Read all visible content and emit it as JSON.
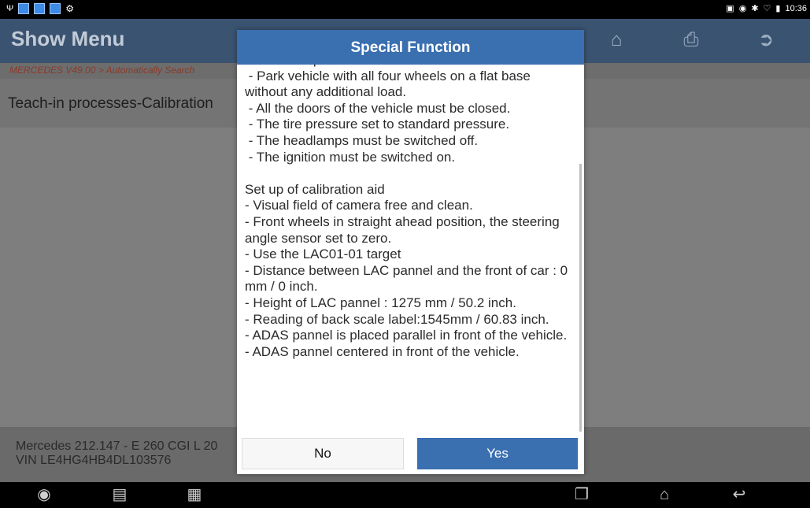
{
  "status_bar": {
    "time": "10:36"
  },
  "header": {
    "title": "Show Menu"
  },
  "toolbar": {
    "home_icon": "home-icon",
    "print_icon": "print-icon",
    "exit_icon": "exit-icon"
  },
  "breadcrumb": "MERCEDES V49.00 > Automatically Search",
  "section": {
    "title": "Teach-in processes-Calibration"
  },
  "vehicle": {
    "model": "Mercedes 212.147 - E 260 CGI L 20",
    "vin": "VIN LE4HG4HB4DL103576"
  },
  "dialog": {
    "title": "Special Function",
    "body": "- Vehicle is placed on a level surface.\n - Park vehicle with all four wheels on a flat base without any additional load.\n - All the doors of the vehicle must be closed.\n - The tire pressure set to standard pressure.\n - The headlamps must be switched off.\n - The ignition must be switched on.\n\nSet up of calibration aid\n- Visual field of camera free and clean.\n- Front wheels in straight ahead position, the steering angle sensor set to zero.\n- Use the LAC01-01 target\n- Distance between LAC pannel and the front of car : 0 mm / 0 inch.\n- Height of LAC pannel : 1275 mm / 50.2 inch.\n- Reading of back scale label:1545mm / 60.83 inch.\n- ADAS pannel is placed parallel in front of the vehicle.\n- ADAS pannel centered in front of the vehicle.",
    "no_label": "No",
    "yes_label": "Yes"
  },
  "colors": {
    "accent": "#3a6fb0",
    "header_bg": "#3a5371"
  }
}
